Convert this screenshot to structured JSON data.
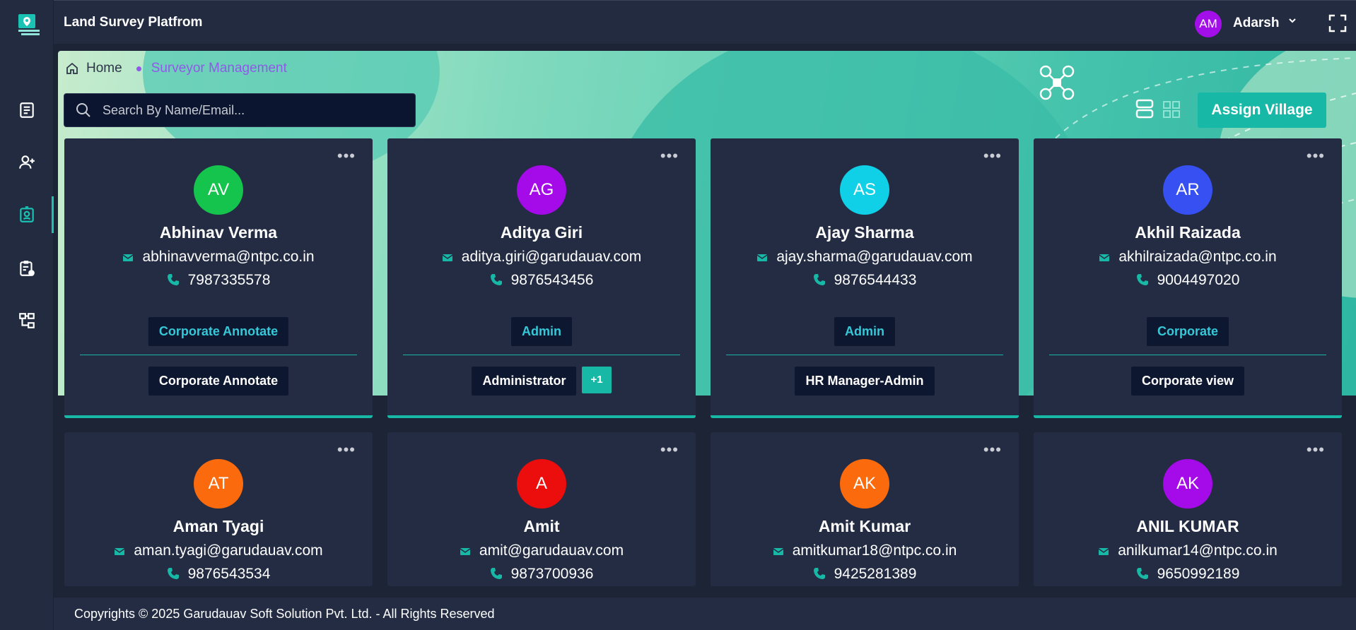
{
  "app": {
    "title": "Land Survey Platfrom"
  },
  "user": {
    "initials": "AM",
    "name": "Adarsh"
  },
  "breadcrumb": {
    "home": "Home",
    "current": "Surveyor Management"
  },
  "search": {
    "placeholder": "Search By Name/Email..."
  },
  "actions": {
    "assign_label": "Assign Village"
  },
  "colors": {
    "accent": "#17b9a6",
    "role_text": "#35c8d8",
    "breadcrumb_active": "#8f5ae8"
  },
  "surveyors": [
    {
      "initials": "AV",
      "name": "Abhinav Verma",
      "email": "abhinavverma@ntpc.co.in",
      "phone": "7987335578",
      "role": "Corporate Annotate",
      "permission": "Corporate Annotate",
      "extra": "",
      "avatar_color": "#14c44d"
    },
    {
      "initials": "AG",
      "name": "Aditya Giri",
      "email": "aditya.giri@garudauav.com",
      "phone": "9876543456",
      "role": "Admin",
      "permission": "Administrator",
      "extra": "+1",
      "avatar_color": "#a40be8"
    },
    {
      "initials": "AS",
      "name": "Ajay Sharma",
      "email": "ajay.sharma@garudauav.com",
      "phone": "9876544433",
      "role": "Admin",
      "permission": "HR Manager-Admin",
      "extra": "",
      "avatar_color": "#0fd0e6"
    },
    {
      "initials": "AR",
      "name": "Akhil Raizada",
      "email": "akhilraizada@ntpc.co.in",
      "phone": "9004497020",
      "role": "Corporate",
      "permission": "Corporate view",
      "extra": "",
      "avatar_color": "#3650f2"
    },
    {
      "initials": "AT",
      "name": "Aman Tyagi",
      "email": "aman.tyagi@garudauav.com",
      "phone": "9876543534",
      "avatar_color": "#fb6a0d"
    },
    {
      "initials": "A",
      "name": "Amit",
      "email": "amit@garudauav.com",
      "phone": "9873700936",
      "avatar_color": "#ec0d0d"
    },
    {
      "initials": "AK",
      "name": "Amit Kumar",
      "email": "amitkumar18@ntpc.co.in",
      "phone": "9425281389",
      "avatar_color": "#fb6a0d"
    },
    {
      "initials": "AK",
      "name": "ANIL KUMAR",
      "email": "anilkumar14@ntpc.co.in",
      "phone": "9650992189",
      "avatar_color": "#a40be8"
    }
  ],
  "footer": {
    "text": "Copyrights © 2025 Garudauav Soft Solution Pvt. Ltd. - All Rights Reserved"
  }
}
